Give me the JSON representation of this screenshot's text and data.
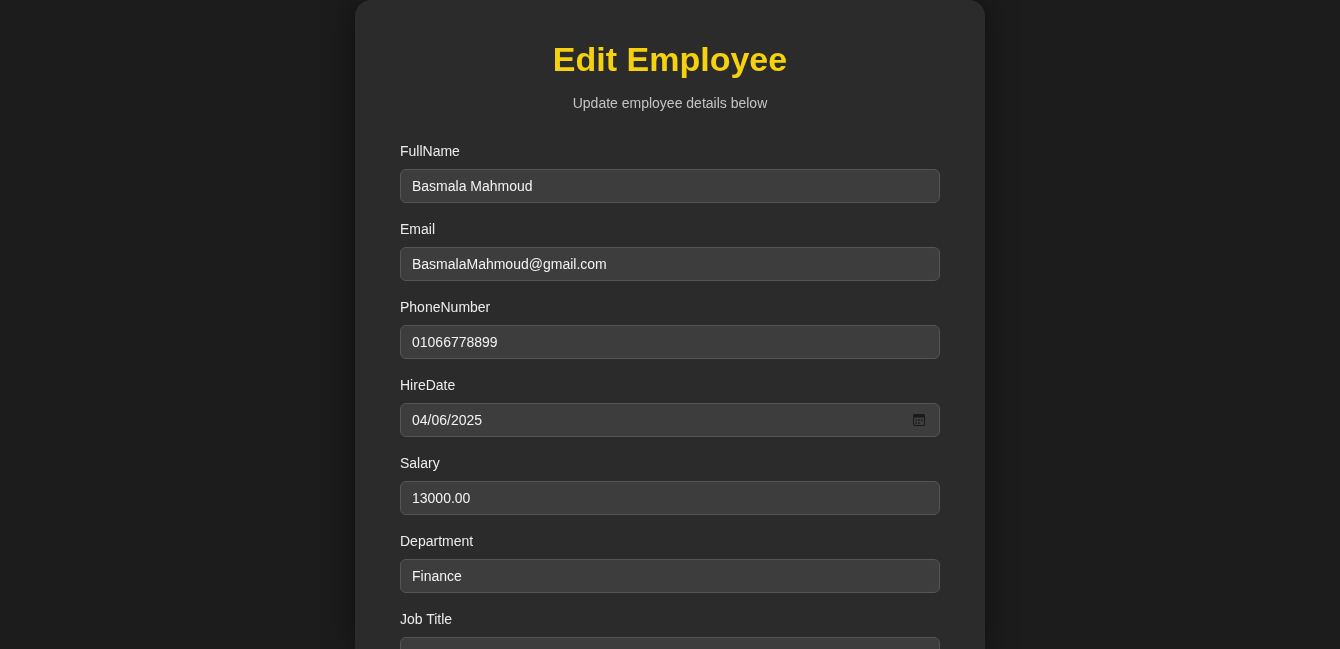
{
  "title": "Edit Employee",
  "subtitle": "Update employee details below",
  "fields": [
    {
      "label": "FullName",
      "value": "Basmala Mahmoud",
      "kind": "text"
    },
    {
      "label": "Email",
      "value": "BasmalaMahmoud@gmail.com",
      "kind": "text"
    },
    {
      "label": "PhoneNumber",
      "value": "01066778899",
      "kind": "text"
    },
    {
      "label": "HireDate",
      "value": "04/06/2025",
      "kind": "date"
    },
    {
      "label": "Salary",
      "value": "13000.00",
      "kind": "text"
    },
    {
      "label": "Department",
      "value": "Finance",
      "kind": "text"
    },
    {
      "label": "Job Title",
      "kind": "text"
    }
  ]
}
